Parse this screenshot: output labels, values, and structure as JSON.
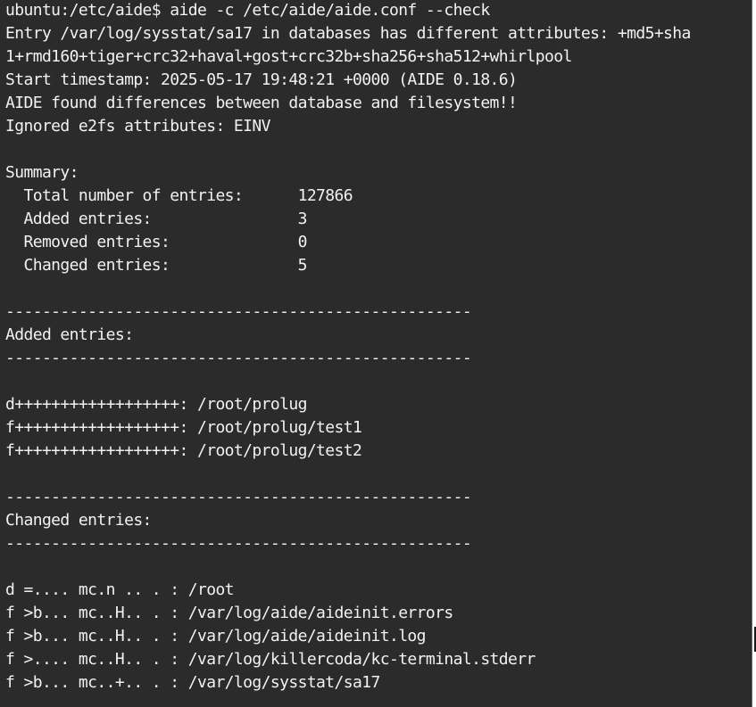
{
  "terminal": {
    "lines": [
      "ubuntu:/etc/aide$ aide -c /etc/aide/aide.conf --check",
      "Entry /var/log/sysstat/sa17 in databases has different attributes: +md5+sha",
      "1+rmd160+tiger+crc32+haval+gost+crc32b+sha256+sha512+whirlpool",
      "Start timestamp: 2025-05-17 19:48:21 +0000 (AIDE 0.18.6)",
      "AIDE found differences between database and filesystem!!",
      "Ignored e2fs attributes: EINV",
      "",
      "Summary:",
      "  Total number of entries:      127866",
      "  Added entries:                3",
      "  Removed entries:              0",
      "  Changed entries:              5",
      "",
      "---------------------------------------------------",
      "Added entries:",
      "---------------------------------------------------",
      "",
      "d++++++++++++++++++: /root/prolug",
      "f++++++++++++++++++: /root/prolug/test1",
      "f++++++++++++++++++: /root/prolug/test2",
      "",
      "---------------------------------------------------",
      "Changed entries:",
      "---------------------------------------------------",
      "",
      "d =.... mc.n .. . : /root",
      "f >b... mc..H.. . : /var/log/aide/aideinit.errors",
      "f >b... mc..H.. . : /var/log/aide/aideinit.log",
      "f >.... mc..H.. . : /var/log/killercoda/kc-terminal.stderr",
      "f >b... mc..+.. . : /var/log/sysstat/sa17"
    ]
  }
}
